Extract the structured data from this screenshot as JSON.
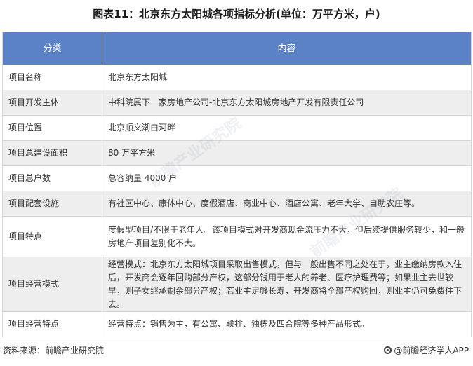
{
  "title": "图表11：北京东方太阳城各项指标分析(单位：万平方米，户)",
  "table": {
    "headers": [
      "分类",
      "内容"
    ],
    "rows": [
      {
        "category": "项目名称",
        "content": "北京东方太阳城"
      },
      {
        "category": "项目开发主体",
        "content": "中科院属下一家房地产公司-北京东方太阳城房地产开发有限责任公司"
      },
      {
        "category": "项目位置",
        "content": "北京顺义潮白河畔"
      },
      {
        "category": "项目总建设面积",
        "content": "80 万平方米"
      },
      {
        "category": "项目总户数",
        "content": "总容纳量 4000 户"
      },
      {
        "category": "项目配套设施",
        "content": "有社区中心、康体中心、度假酒店、商业中心、酒店公寓、老年大学、自助农庄等。"
      },
      {
        "category": "项目特点",
        "content": "度假型项目/不限于老年人。该项目模式对开发商现金流压力不大，但后续提供服务较少，和一般房地产项目差别化不大。"
      },
      {
        "category": "项目经营模式",
        "content": "经营模式：北京东方太阳城项目采取出售模式，但与一般出售不同之处在于，业主缴纳房款入住后，开发商会逐年回购部分产权，这部分钱用于老人的养老、医疗护理费等；如果业主去世较早，则子女继承剩余部分产权；若业主足够长寿，开发商将全部产权购回，则业主仍可免费住下去。"
      },
      {
        "category": "项目经营特点",
        "content": "经营特点：销售为主，有公寓、联排、独栋及四合院等多种产品形式。"
      }
    ]
  },
  "footer": {
    "source": "资料来源：前瞻产业研究院",
    "brand": "@前瞻经济学人APP"
  },
  "watermark": "前瞻产业研究院",
  "colors": {
    "header_bg": "#5b82c6",
    "row_alt_bg": "#eeeeee"
  }
}
